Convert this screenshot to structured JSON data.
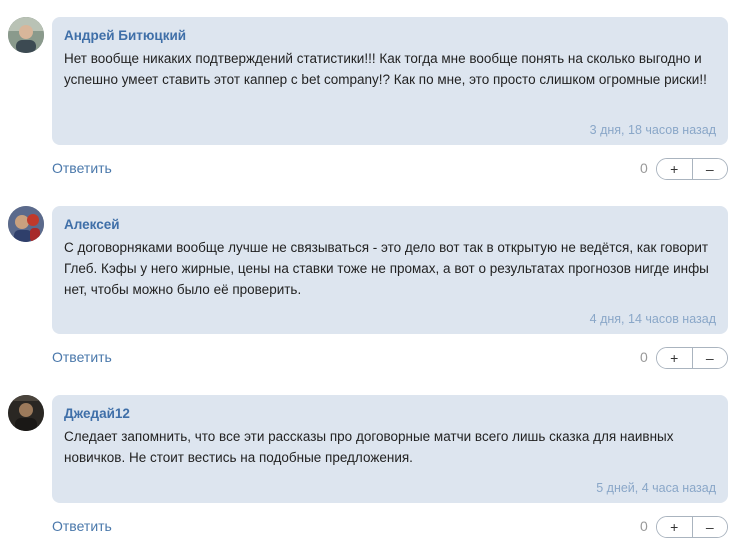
{
  "comments": [
    {
      "author": "Андрей Битюцкий",
      "text": "Нет вообще никаких подтверждений статистики!!! Как тогда мне вообще понять на сколько выгодно и успешно умеет ставить этот каппер с bet company!? Как по мне, это просто слишком огромные риски!!",
      "date": "3 дня, 18 часов назад",
      "reply_label": "Ответить",
      "score": "0",
      "plus_label": "+",
      "minus_label": "–"
    },
    {
      "author": "Алексей",
      "text": "С договорняками вообще лучше не связываться - это дело вот так в открытую не ведётся, как говорит Глеб. Кэфы у него жирные, цены на ставки тоже не промах, а вот о результатах прогнозов нигде инфы нет, чтобы можно было её проверить.",
      "date": "4 дня, 14 часов назад",
      "reply_label": "Ответить",
      "score": "0",
      "plus_label": "+",
      "minus_label": "–"
    },
    {
      "author": "Джедай12",
      "text": "Следает запомнить, что все эти рассказы про договорные матчи всего лишь сказка для наивных новичков. Не стоит вестись на подобные предложения.",
      "date": "5 дней, 4 часа назад",
      "reply_label": "Ответить",
      "score": "0",
      "plus_label": "+",
      "minus_label": "–"
    }
  ]
}
